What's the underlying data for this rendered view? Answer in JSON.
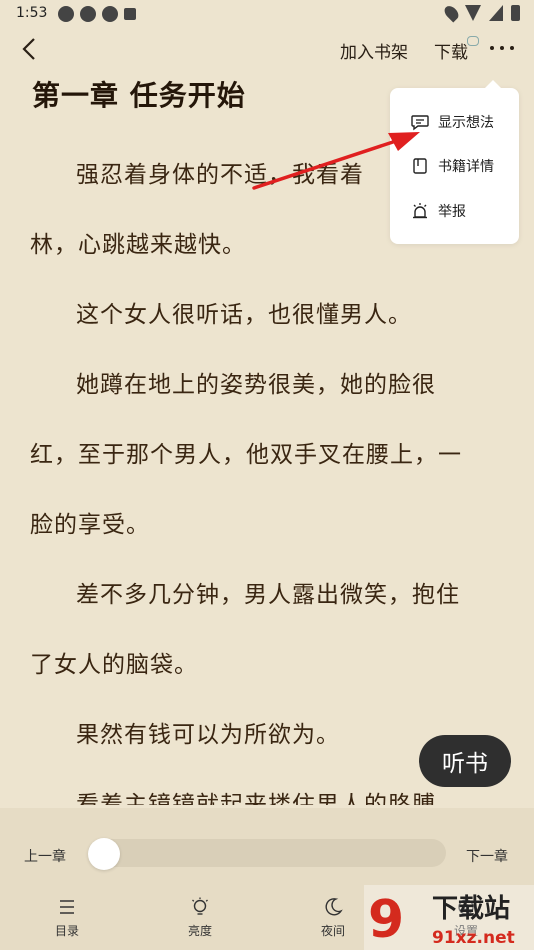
{
  "status_bar": {
    "time": "1:53"
  },
  "nav": {
    "add_shelf": "加入书架",
    "download": "下载"
  },
  "chapter": {
    "title": "第一章 任务开始",
    "paragraphs": [
      "强忍着身体的不适，我看着",
      "林，心跳越来越快。",
      "这个女人很听话，也很懂男人。",
      "她蹲在地上的姿势很美，她的脸很",
      "红，至于那个男人，他双手叉在腰上，一",
      "脸的享受。",
      "差不多几分钟，男人露出微笑，抱住",
      "了女人的脑袋。",
      "果然有钱可以为所欲为。",
      "看着主镜镜就起来搂住男人的胳膊"
    ]
  },
  "menu": {
    "items": [
      {
        "label": "显示想法",
        "icon": "comment-icon"
      },
      {
        "label": "书籍详情",
        "icon": "book-detail-icon"
      },
      {
        "label": "举报",
        "icon": "alarm-icon"
      }
    ]
  },
  "listen": {
    "label": "听书"
  },
  "bottom": {
    "prev": "上一章",
    "next": "下一章",
    "progress": 0.0,
    "tabs": [
      {
        "label": "目录"
      },
      {
        "label": "亮度"
      },
      {
        "label": "夜间"
      },
      {
        "label": "设置"
      }
    ]
  },
  "watermark": {
    "text": "下载站",
    "sub": "91xz.net",
    "logo": "9"
  },
  "colors": {
    "background": "#ede4cf",
    "arrow": "#e02020",
    "listen_btn": "#2f2f2f"
  }
}
